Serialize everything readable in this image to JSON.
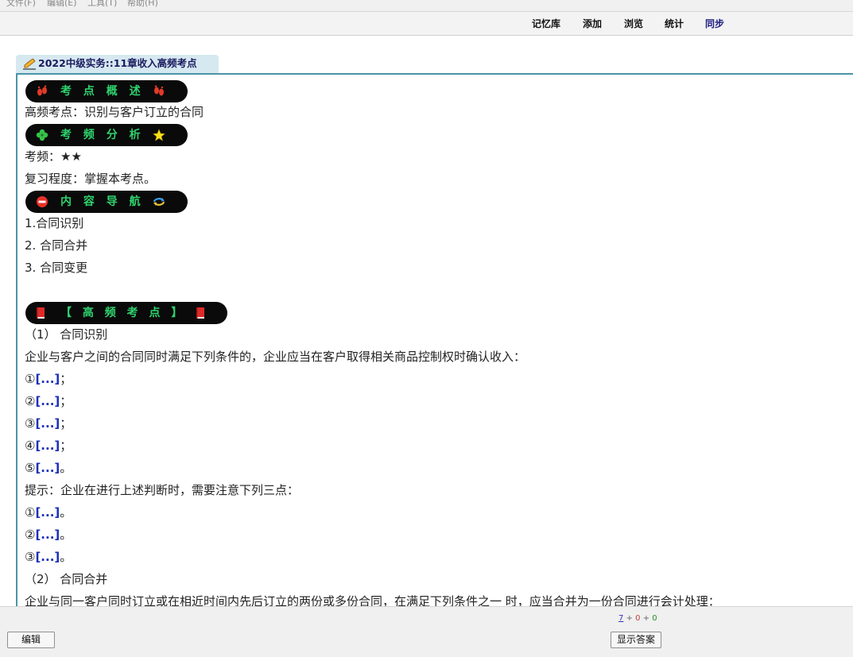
{
  "menu": [
    "文件(F)",
    "编辑(E)",
    "工具(T)",
    "帮助(H)"
  ],
  "toolbar": {
    "decks": "记忆库",
    "add": "添加",
    "browse": "浏览",
    "stats": "统计",
    "sync": "同步"
  },
  "deck": {
    "title": "2022中级实务::11章收入高频考点",
    "icon": "pen-icon"
  },
  "card": {
    "section1_header": "考 点 概 述",
    "section1_icon": "footprint-icon",
    "topic_line": "高频考点：识别与客户订立的合同",
    "section2_header": "考 频 分 析",
    "section2_icons": [
      "clover-icon",
      "star-icon"
    ],
    "frequency_line": "考频：★★",
    "review_line": "复习程度：掌握本考点。",
    "section3_header": "内 容 导 航",
    "section3_icons": [
      "stop-icon",
      "refresh-icon"
    ],
    "nav_items": [
      "1.合同识别",
      "2. 合同合并",
      "3. 合同变更"
    ],
    "section4_header": "【 高 频 考 点 】",
    "section4_icon": "book-icon",
    "sub1_title": "（1） 合同识别",
    "sub1_intro": "企业与客户之间的合同同时满足下列条件的，企业应当在客户取得相关商品控制权时确认收入：",
    "cloze_text": "[...]",
    "conditions": [
      {
        "num": "①",
        "end": "；"
      },
      {
        "num": "②",
        "end": "；"
      },
      {
        "num": "③",
        "end": "；"
      },
      {
        "num": "④",
        "end": "；"
      },
      {
        "num": "⑤",
        "end": "。"
      }
    ],
    "hint_line": "提示：企业在进行上述判断时，需要注意下列三点：",
    "hints": [
      {
        "num": "①",
        "end": "。"
      },
      {
        "num": "②",
        "end": "。"
      },
      {
        "num": "③",
        "end": "。"
      }
    ],
    "sub2_title": "（2） 合同合并",
    "sub2_intro": "企业与同一客户同时订立或在相近时间内先后订立的两份或多份合同，在满足下列条件之一  时，应当合并为一份合同进行会计处理："
  },
  "bottom": {
    "edit_button": "编辑",
    "show_answer_button": "显示答案",
    "count_new": "7",
    "count_learning": "0",
    "count_review": "0",
    "plus": "+"
  },
  "colors": {
    "accent_border": "#4a95a8",
    "pill_bg": "#0a0a0a",
    "pill_text": "#2fd36e",
    "cloze": "#1a2fb8"
  }
}
